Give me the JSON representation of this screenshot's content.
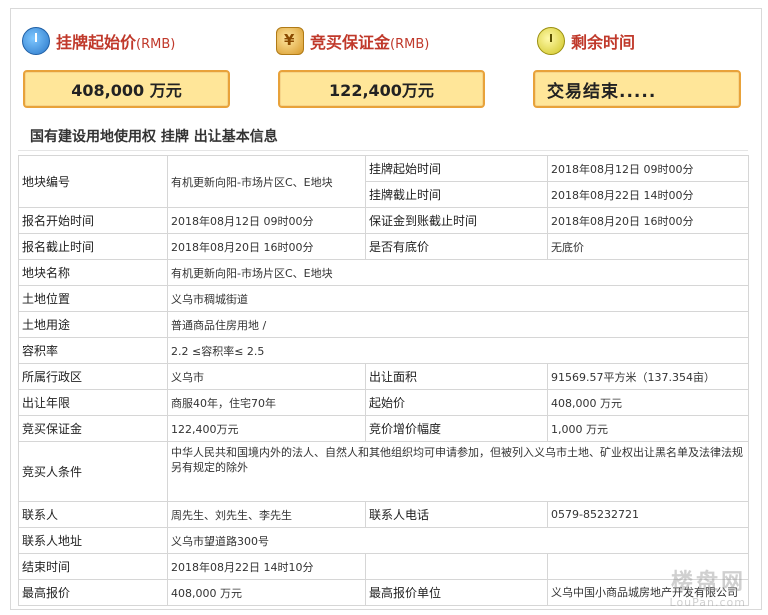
{
  "header": {
    "stats": [
      {
        "label": "挂牌起始价",
        "unit": "(RMB)",
        "icon": "clock-icon"
      },
      {
        "label": "竞买保证金",
        "unit": "(RMB)",
        "icon": "money-bag-icon"
      },
      {
        "label": "剩余时间",
        "unit": "",
        "icon": "alarm-clock-icon"
      }
    ],
    "values": {
      "start_price": "408,000 万元",
      "deposit": "122,400万元",
      "remaining": "交易结束....."
    }
  },
  "section_title": "国有建设用地使用权 挂牌 出让基本信息",
  "table": {
    "r1": {
      "k1": "地块编号",
      "v1": "有机更新向阳-市场片区C、E地块",
      "k2a": "挂牌起始时间",
      "v2a": "2018年08月12日 09时00分",
      "k2b": "挂牌截止时间",
      "v2b": "2018年08月22日 14时00分"
    },
    "r2": {
      "k1": "报名开始时间",
      "v1": "2018年08月12日 09时00分",
      "k2": "保证金到账截止时间",
      "v2": "2018年08月20日 16时00分"
    },
    "r3": {
      "k1": "报名截止时间",
      "v1": "2018年08月20日 16时00分",
      "k2": "是否有底价",
      "v2": "无底价"
    },
    "r4": {
      "k1": "地块名称",
      "v1": "有机更新向阳-市场片区C、E地块"
    },
    "r5": {
      "k1": "土地位置",
      "v1": "义乌市稠城街道"
    },
    "r6": {
      "k1": "土地用途",
      "v1": "普通商品住房用地 /"
    },
    "r7": {
      "k1": "容积率",
      "v1": "2.2 ≤容积率≤ 2.5"
    },
    "r8": {
      "k1": "所属行政区",
      "v1": "义乌市",
      "k2": "出让面积",
      "v2": "91569.57平方米（137.354亩）"
    },
    "r9": {
      "k1": "出让年限",
      "v1": "商服40年，住宅70年",
      "k2": "起始价",
      "v2": "408,000 万元"
    },
    "r10": {
      "k1": "竞买保证金",
      "v1": "122,400万元",
      "k2": "竞价增价幅度",
      "v2": "1,000 万元"
    },
    "r11": {
      "k1": "竞买人条件",
      "v1": "中华人民共和国境内外的法人、自然人和其他组织均可申请参加，但被列入义乌市土地、矿业权出让黑名单及法律法规另有规定的除外"
    },
    "r12": {
      "k1": "联系人",
      "v1": "周先生、刘先生、李先生",
      "k2": "联系人电话",
      "v2": "0579-85232721"
    },
    "r13": {
      "k1": "联系人地址",
      "v1": "义乌市望道路300号"
    },
    "r14": {
      "k1": "结束时间",
      "v1": "2018年08月22日 14时10分"
    },
    "r15": {
      "k1": "最高报价",
      "v1": "408,000 万元",
      "k2": "最高报价单位",
      "v2": "义乌中国小商品城房地产开发有限公司"
    }
  },
  "watermark": {
    "line1": "楼盘网",
    "line2": "LouPan.com"
  }
}
